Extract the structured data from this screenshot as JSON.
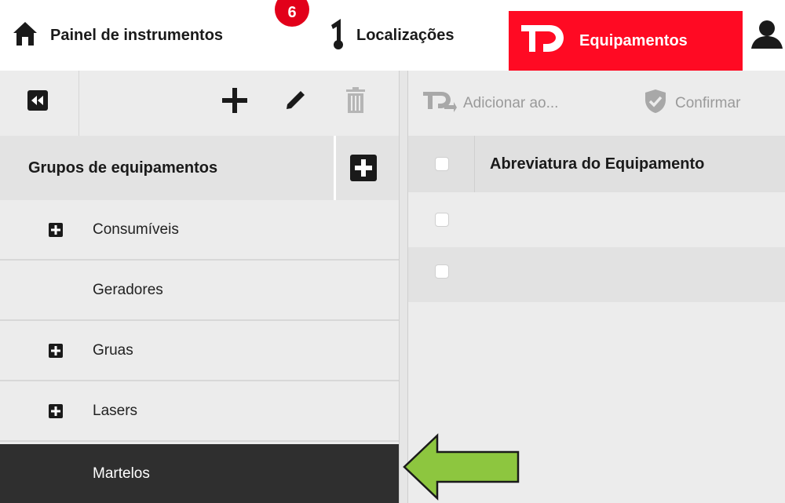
{
  "nav": {
    "dashboard_label": "Painel de instrumentos",
    "notification_count": "6",
    "locations_label": "Localizações",
    "equipment_label": "Equipamentos"
  },
  "sidebar": {
    "header_title": "Grupos de equipamentos",
    "groups": [
      {
        "label": "Consumíveis",
        "expandable": true
      },
      {
        "label": "Geradores",
        "expandable": false
      },
      {
        "label": "Gruas",
        "expandable": true
      },
      {
        "label": "Lasers",
        "expandable": true
      },
      {
        "label": "Martelos",
        "expandable": false,
        "selected": true
      }
    ]
  },
  "main": {
    "toolbar": {
      "add_to_label": "Adicionar ao...",
      "confirm_label": "Confirmar"
    },
    "table": {
      "column_abbreviation": "Abreviatura do Equipamento",
      "row_count": 2
    }
  },
  "colors": {
    "brand_red": "#ff0a23",
    "selected_bg": "#2f2f2f",
    "arrow_green": "#8dc63f"
  }
}
